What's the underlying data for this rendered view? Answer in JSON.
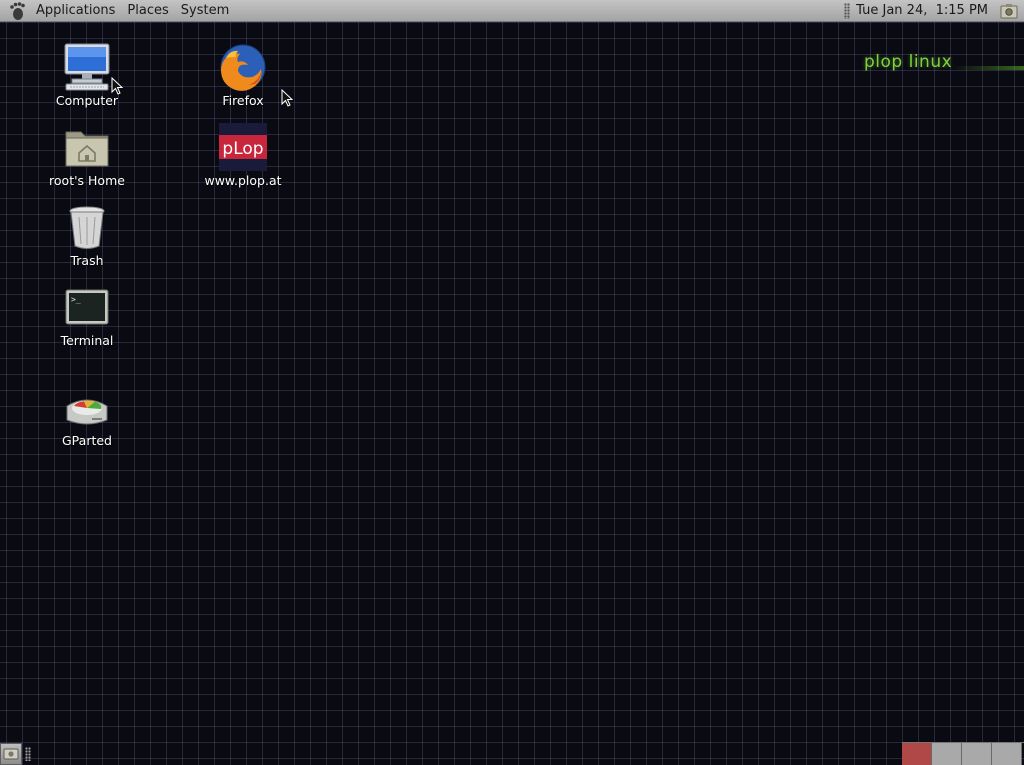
{
  "top_panel": {
    "menus": [
      "Applications",
      "Places",
      "System"
    ],
    "clock": "Tue Jan 24,  1:15 PM"
  },
  "desktop": {
    "icons": [
      {
        "label": "Computer",
        "icon": "computer-icon"
      },
      {
        "label": "root's Home",
        "icon": "home-folder-icon"
      },
      {
        "label": "Trash",
        "icon": "trash-icon"
      },
      {
        "label": "Terminal",
        "icon": "terminal-icon"
      },
      {
        "label": "GParted",
        "icon": "gparted-icon"
      },
      {
        "label": "Firefox",
        "icon": "firefox-icon"
      },
      {
        "label": "www.plop.at",
        "icon": "plop-icon",
        "logo_text": "pLop"
      }
    ],
    "brand": "plop linux"
  },
  "bottom_panel": {
    "workspaces": [
      {
        "name": "workspace-1",
        "active": true
      },
      {
        "name": "workspace-2",
        "active": false
      },
      {
        "name": "workspace-3",
        "active": false
      },
      {
        "name": "workspace-4",
        "active": false
      }
    ]
  },
  "colors": {
    "desktop_bg": "#0a0a12",
    "grid_line": "#6a6a9a",
    "panel": "#b4b4b4",
    "brand_green": "#7fd23a",
    "active_workspace": "#b04848"
  }
}
